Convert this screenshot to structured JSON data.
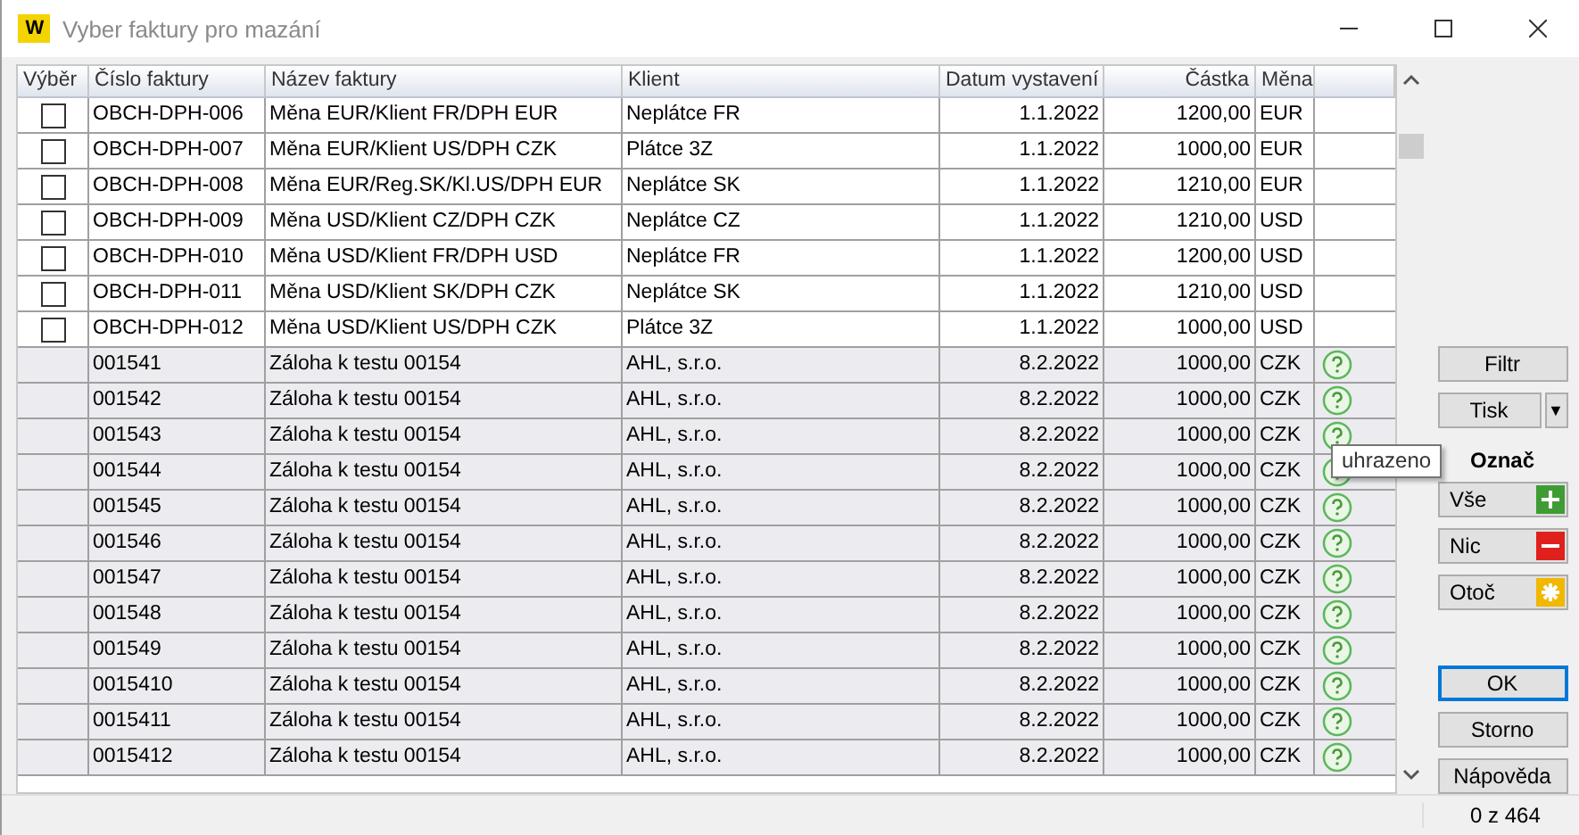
{
  "window": {
    "title": "Vyber faktury pro mazání",
    "logo": "W"
  },
  "table": {
    "columns": [
      "Výběr",
      "Číslo faktury",
      "Název faktury",
      "Klient",
      "Datum vystavení",
      "Částka",
      "Měna"
    ],
    "rows": [
      {
        "kind": "selectable",
        "checked": false,
        "number": "OBCH-DPH-006",
        "name": "Měna EUR/Klient FR/DPH EUR",
        "client": "Neplátce FR",
        "date": "1.1.2022",
        "amount": "1200,00",
        "currency": "EUR"
      },
      {
        "kind": "selectable",
        "checked": false,
        "number": "OBCH-DPH-007",
        "name": "Měna EUR/Klient US/DPH CZK",
        "client": "Plátce 3Z",
        "date": "1.1.2022",
        "amount": "1000,00",
        "currency": "EUR"
      },
      {
        "kind": "selectable",
        "checked": false,
        "number": "OBCH-DPH-008",
        "name": "Měna EUR/Reg.SK/Kl.US/DPH EUR",
        "client": "Neplátce SK",
        "date": "1.1.2022",
        "amount": "1210,00",
        "currency": "EUR"
      },
      {
        "kind": "selectable",
        "checked": false,
        "number": "OBCH-DPH-009",
        "name": "Měna USD/Klient CZ/DPH CZK",
        "client": "Neplátce CZ",
        "date": "1.1.2022",
        "amount": "1210,00",
        "currency": "USD"
      },
      {
        "kind": "selectable",
        "checked": false,
        "number": "OBCH-DPH-010",
        "name": "Měna USD/Klient FR/DPH USD",
        "client": "Neplátce FR",
        "date": "1.1.2022",
        "amount": "1200,00",
        "currency": "USD"
      },
      {
        "kind": "selectable",
        "checked": false,
        "number": "OBCH-DPH-011",
        "name": "Měna USD/Klient SK/DPH CZK",
        "client": "Neplátce SK",
        "date": "1.1.2022",
        "amount": "1210,00",
        "currency": "USD"
      },
      {
        "kind": "selectable",
        "checked": false,
        "number": "OBCH-DPH-012",
        "name": "Měna USD/Klient US/DPH CZK",
        "client": "Plátce 3Z",
        "date": "1.1.2022",
        "amount": "1000,00",
        "currency": "USD"
      },
      {
        "kind": "locked",
        "number": "001541",
        "name": "Záloha k testu 00154",
        "client": "AHL, s.r.o.",
        "date": "8.2.2022",
        "amount": "1000,00",
        "currency": "CZK"
      },
      {
        "kind": "locked",
        "number": "001542",
        "name": "Záloha k testu 00154",
        "client": "AHL, s.r.o.",
        "date": "8.2.2022",
        "amount": "1000,00",
        "currency": "CZK"
      },
      {
        "kind": "locked",
        "number": "001543",
        "name": "Záloha k testu 00154",
        "client": "AHL, s.r.o.",
        "date": "8.2.2022",
        "amount": "1000,00",
        "currency": "CZK"
      },
      {
        "kind": "locked",
        "number": "001544",
        "name": "Záloha k testu 00154",
        "client": "AHL, s.r.o.",
        "date": "8.2.2022",
        "amount": "1000,00",
        "currency": "CZK"
      },
      {
        "kind": "locked",
        "number": "001545",
        "name": "Záloha k testu 00154",
        "client": "AHL, s.r.o.",
        "date": "8.2.2022",
        "amount": "1000,00",
        "currency": "CZK"
      },
      {
        "kind": "locked",
        "number": "001546",
        "name": "Záloha k testu 00154",
        "client": "AHL, s.r.o.",
        "date": "8.2.2022",
        "amount": "1000,00",
        "currency": "CZK"
      },
      {
        "kind": "locked",
        "number": "001547",
        "name": "Záloha k testu 00154",
        "client": "AHL, s.r.o.",
        "date": "8.2.2022",
        "amount": "1000,00",
        "currency": "CZK"
      },
      {
        "kind": "locked",
        "number": "001548",
        "name": "Záloha k testu 00154",
        "client": "AHL, s.r.o.",
        "date": "8.2.2022",
        "amount": "1000,00",
        "currency": "CZK"
      },
      {
        "kind": "locked",
        "number": "001549",
        "name": "Záloha k testu 00154",
        "client": "AHL, s.r.o.",
        "date": "8.2.2022",
        "amount": "1000,00",
        "currency": "CZK"
      },
      {
        "kind": "locked",
        "number": "0015410",
        "name": "Záloha k testu 00154",
        "client": "AHL, s.r.o.",
        "date": "8.2.2022",
        "amount": "1000,00",
        "currency": "CZK"
      },
      {
        "kind": "locked",
        "number": "0015411",
        "name": "Záloha k testu 00154",
        "client": "AHL, s.r.o.",
        "date": "8.2.2022",
        "amount": "1000,00",
        "currency": "CZK"
      },
      {
        "kind": "locked",
        "number": "0015412",
        "name": "Záloha k testu 00154",
        "client": "AHL, s.r.o.",
        "date": "8.2.2022",
        "amount": "1000,00",
        "currency": "CZK"
      }
    ]
  },
  "tooltip": "uhrazeno",
  "sidebar": {
    "filter": "Filtr",
    "print": "Tisk",
    "print_arrow": "▼",
    "mark_heading": "Označ",
    "mark_buttons": [
      {
        "kind": "all",
        "label": "Vše"
      },
      {
        "kind": "none",
        "label": "Nic"
      },
      {
        "kind": "invert",
        "label": "Otoč"
      }
    ],
    "dialog_buttons": [
      {
        "label": "OK",
        "selected": true
      },
      {
        "label": "Storno",
        "selected": false
      },
      {
        "label": "Nápověda",
        "selected": false
      }
    ]
  },
  "status_bar": {
    "count": "0 z 464"
  }
}
